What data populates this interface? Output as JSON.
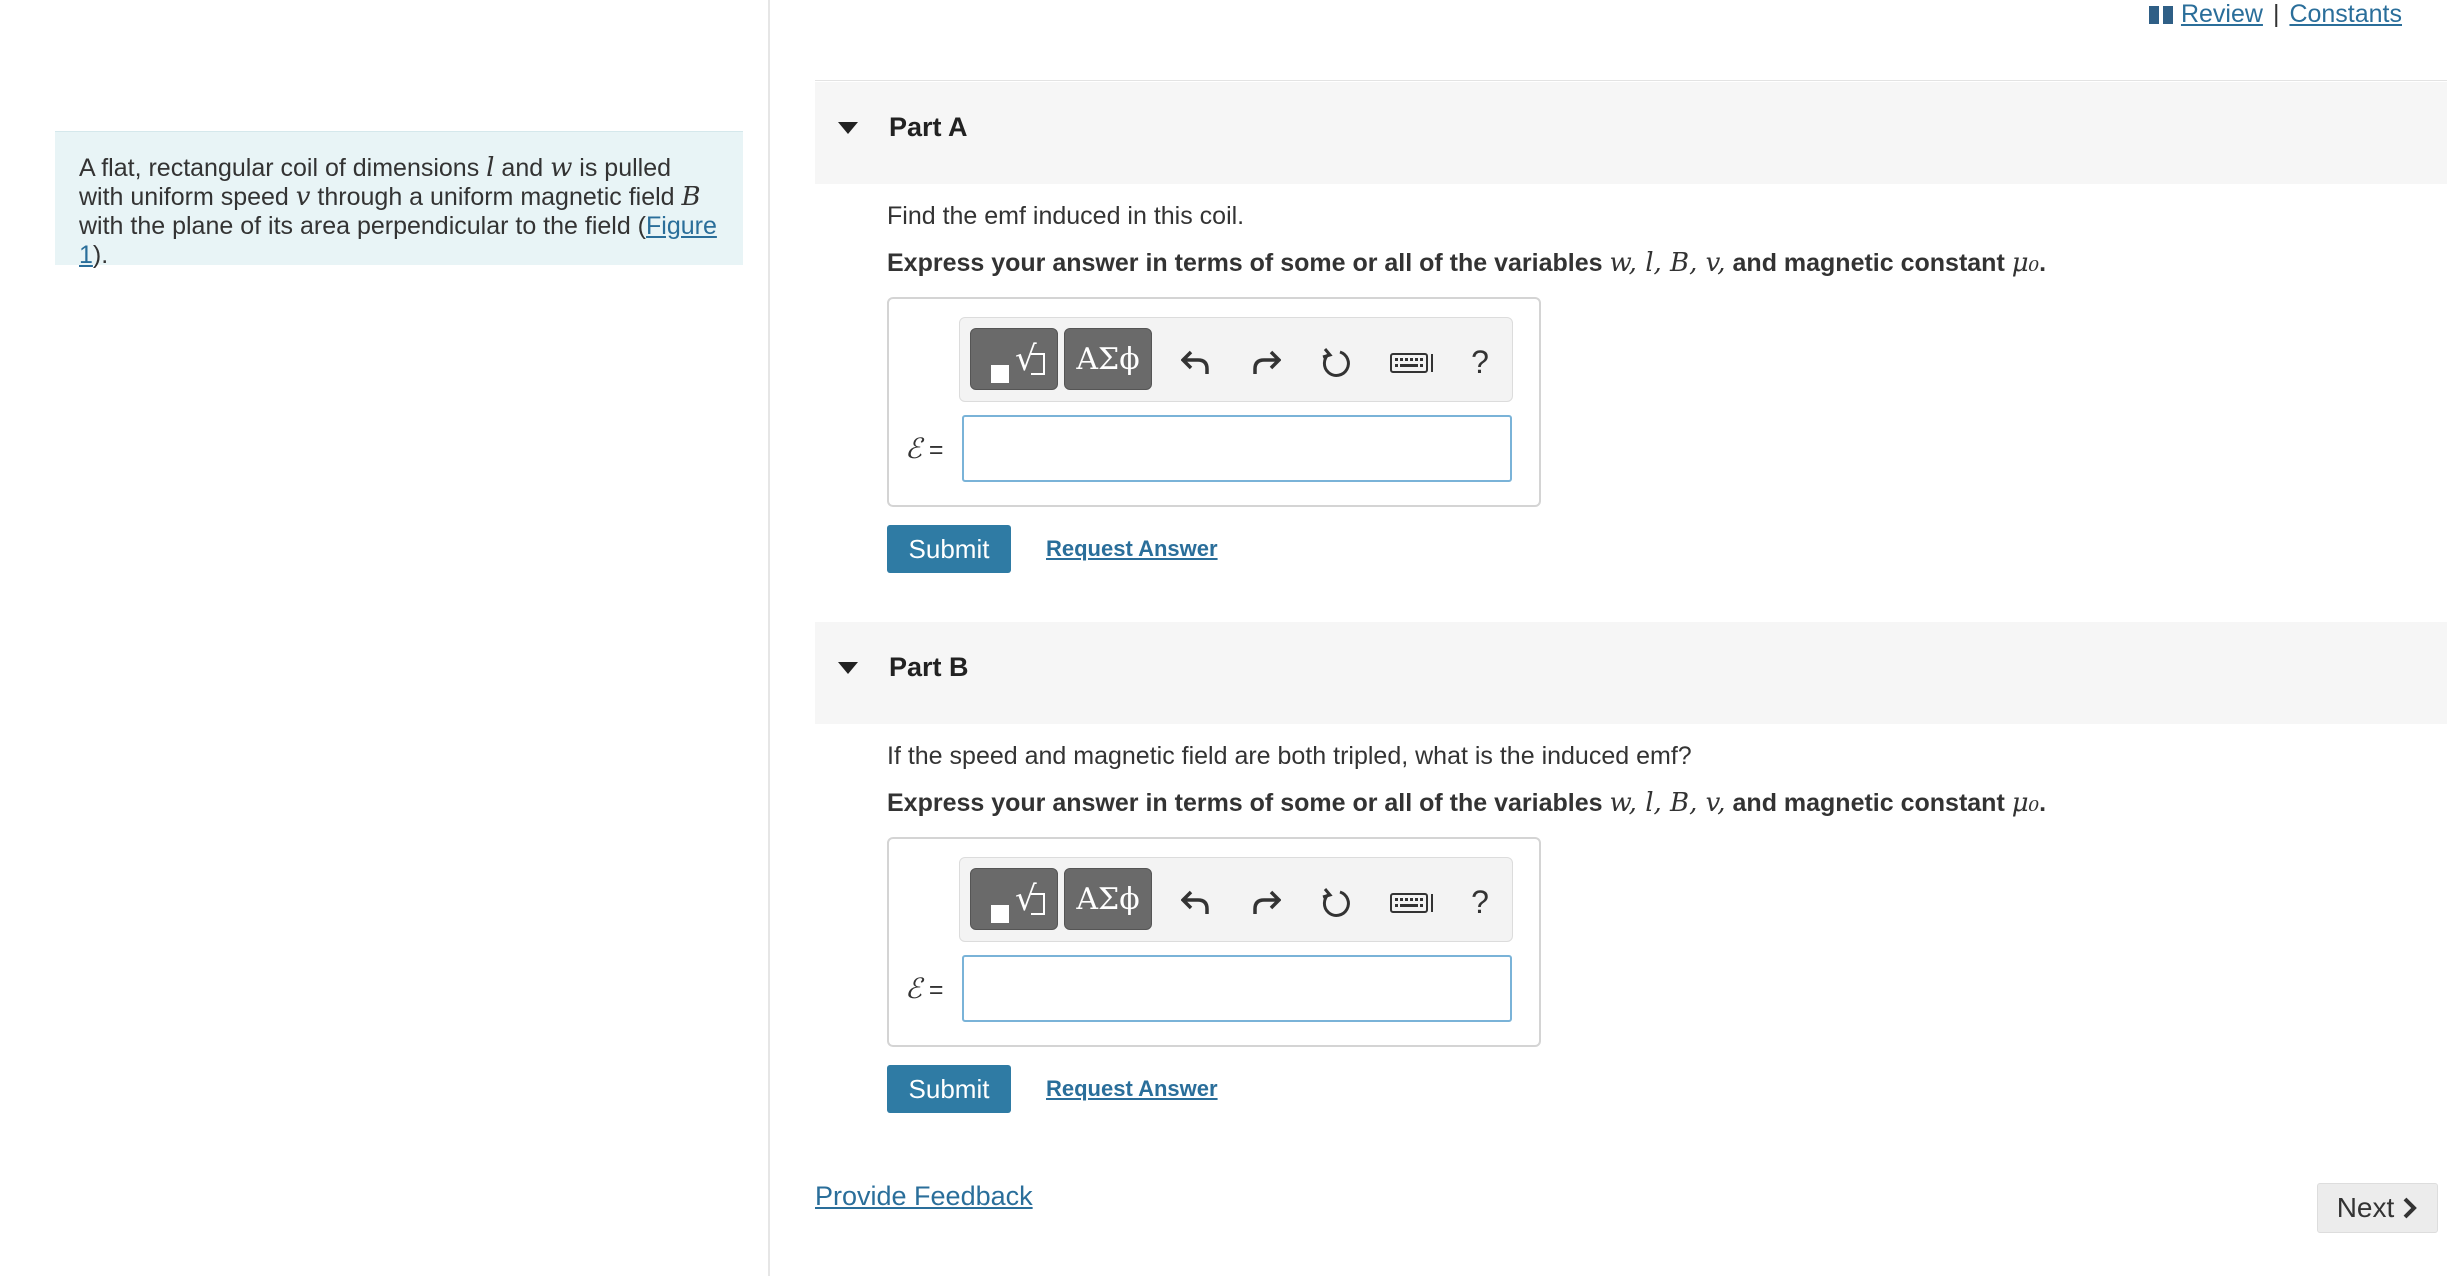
{
  "header": {
    "review_label": "Review",
    "separator": "|",
    "constants_label": "Constants"
  },
  "problem": {
    "text_1": "A flat, rectangular coil of dimensions ",
    "var_l": "l",
    "text_2": " and ",
    "var_w": "w",
    "text_3": " is pulled with uniform speed ",
    "var_v": "v",
    "text_4": " through a uniform magnetic field ",
    "var_B": "B",
    "text_5": " with the plane of its area perpendicular to the field (",
    "figure_link": "Figure 1",
    "text_6": ")."
  },
  "parts": [
    {
      "title": "Part A",
      "question": "Find the emf induced in this coil.",
      "instruction": "Express your answer in terms of some or all of the variables",
      "variables": "w, l, B, v,",
      "instruction_tail": "and magnetic constant",
      "constant": "μ₀",
      "instruction_end": ".",
      "greek_label": "ΑΣϕ",
      "help_label": "?",
      "answer_symbol": "ℰ",
      "answer_eq": " =",
      "answer_value": "",
      "submit_label": "Submit",
      "request_label": "Request Answer"
    },
    {
      "title": "Part B",
      "question": "If the speed and magnetic field are both tripled, what is the induced emf?",
      "instruction": "Express your answer in terms of some or all of the variables",
      "variables": "w, l, B, v,",
      "instruction_tail": "and magnetic constant",
      "constant": "μ₀",
      "instruction_end": ".",
      "greek_label": "ΑΣϕ",
      "help_label": "?",
      "answer_symbol": "ℰ",
      "answer_eq": " =",
      "answer_value": "",
      "submit_label": "Submit",
      "request_label": "Request Answer"
    }
  ],
  "footer": {
    "feedback_label": "Provide Feedback",
    "next_label": "Next"
  },
  "icons": {
    "toolbar": [
      "template-icon",
      "greek-icon",
      "undo-icon",
      "redo-icon",
      "reset-icon",
      "keyboard-icon",
      "help-icon"
    ],
    "nav": [
      "book-icon",
      "chevron-right-icon",
      "caret-down-icon"
    ]
  },
  "colors": {
    "accent": "#2f7ba4",
    "link": "#2a6e9a",
    "problem_bg": "#e8f4f6",
    "toolbar_button": "#6a6a6a"
  }
}
